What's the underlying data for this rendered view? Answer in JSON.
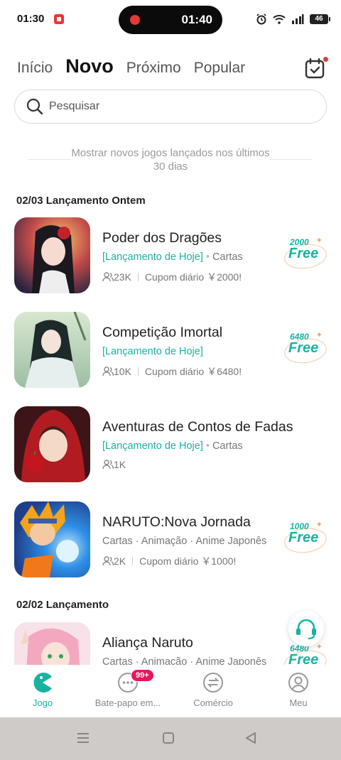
{
  "status_bar": {
    "time": "01:30",
    "recording_time": "01:40",
    "battery": "46"
  },
  "tabs": [
    {
      "label": "Início",
      "active": false
    },
    {
      "label": "Novo",
      "active": true
    },
    {
      "label": "Próximo",
      "active": false
    },
    {
      "label": "Popular",
      "active": false
    }
  ],
  "search": {
    "placeholder": "Pesquisar"
  },
  "notice": "Mostrar novos jogos lançados nos últimos 30 dias",
  "sections": [
    {
      "title": "02/03 Lançamento Ontem",
      "games": [
        {
          "title": "Poder dos Dragões",
          "highlight": "[Lançamento de Hoje]",
          "tags": "Cartas",
          "players": "23K",
          "promo": "Cupom diário ￥2000!",
          "badge_amount": "2000",
          "badge_label": "Free"
        },
        {
          "title": "Competição Imortal",
          "highlight": "[Lançamento de Hoje]",
          "tags": "",
          "players": "10K",
          "promo": "Cupom diário ￥6480!",
          "badge_amount": "6480",
          "badge_label": "Free"
        },
        {
          "title": "Aventuras de Contos de Fadas",
          "highlight": "[Lançamento de Hoje]",
          "tags": "Cartas",
          "players": "1K",
          "promo": "",
          "badge_amount": "",
          "badge_label": ""
        },
        {
          "title": "NARUTO:Nova Jornada",
          "highlight": "",
          "tags": "Cartas · Animação · Anime Japonês",
          "players": "2K",
          "promo": "Cupom diário ￥1000!",
          "badge_amount": "1000",
          "badge_label": "Free"
        }
      ]
    },
    {
      "title": "02/02 Lançamento",
      "games": [
        {
          "title": "Aliança Naruto",
          "highlight": "",
          "tags": "Cartas · Animação · Anime Japonês",
          "players": "",
          "promo": "",
          "badge_amount": "6480",
          "badge_label": "Free"
        }
      ]
    }
  ],
  "bottom_nav": [
    {
      "label": "Jogo",
      "active": true
    },
    {
      "label": "Bate-papo em...",
      "badge": "99+"
    },
    {
      "label": "Comércio"
    },
    {
      "label": "Meu"
    }
  ],
  "colors": {
    "accent": "#18b3a0",
    "badge_red": "#e8175d",
    "status_red": "#e53935"
  }
}
